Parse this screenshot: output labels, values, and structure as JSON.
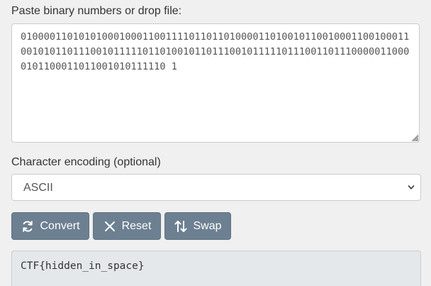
{
  "input": {
    "label": "Paste binary numbers or drop file:",
    "value": "010000110101010001000110011110110110100001101001011001000110010001100101011011100101111101101001011011100101111101110011011100000110000101100011011001010111110 1"
  },
  "encoding": {
    "label": "Character encoding (optional)",
    "selected": "ASCII"
  },
  "buttons": {
    "convert_label": "Convert",
    "convert_icon": "refresh-icon",
    "reset_label": "Reset",
    "reset_icon": "close-icon",
    "swap_label": "Swap",
    "swap_icon": "swap-vertical-icon"
  },
  "output": {
    "value": "CTF{hidden_in_space}"
  },
  "colors": {
    "page_background": "#f0f0f0",
    "button_background": "#6c8091",
    "output_background": "#e5e8ea",
    "border": "#cccccc"
  }
}
